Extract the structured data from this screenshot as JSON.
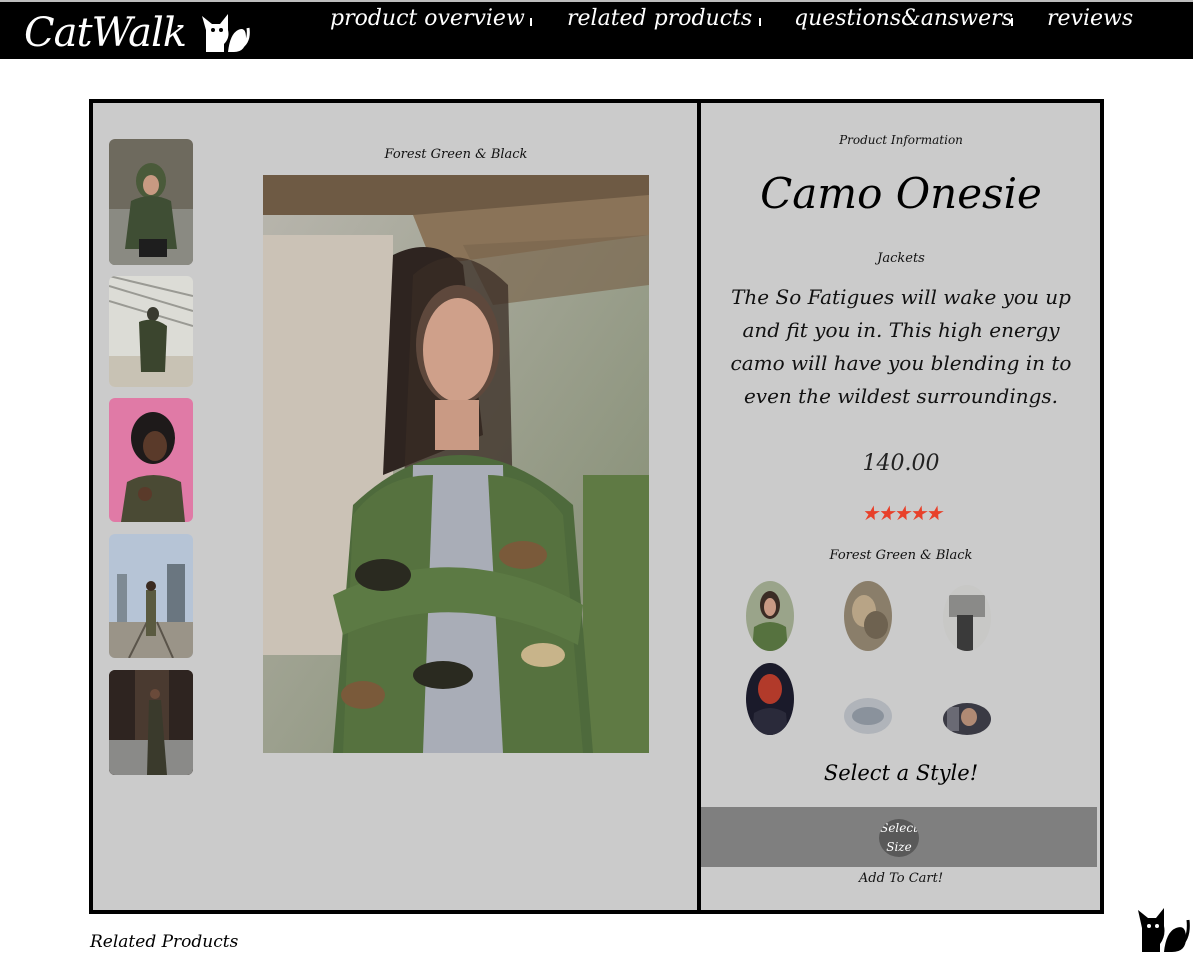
{
  "header": {
    "logo_text": "CatWalk",
    "nav": [
      "product overview",
      "related products",
      "questions&answers",
      "reviews"
    ]
  },
  "gallery": {
    "caption": "Forest Green & Black",
    "thumbnail_count": 5
  },
  "product": {
    "section_title": "Product Information",
    "name": "Camo Onesie",
    "category": "Jackets",
    "description": "The So Fatigues will wake you up and fit you in. This high energy camo will have you blending in to even the wildest surroundings.",
    "price": "140.00",
    "rating": 4.75,
    "rating_stars": "★★★★★",
    "style_name": "Forest Green & Black",
    "select_style_label": "Select a Style!",
    "size_button_label": "Select Size",
    "add_to_cart_label": "Add To Cart!"
  },
  "related": {
    "title": "Related Products"
  },
  "colors": {
    "rating": "#e8402a",
    "panel": "#cbcbcb",
    "header": "#000000"
  },
  "icons": [
    "cat-logo-icon",
    "cat-corner-icon"
  ]
}
